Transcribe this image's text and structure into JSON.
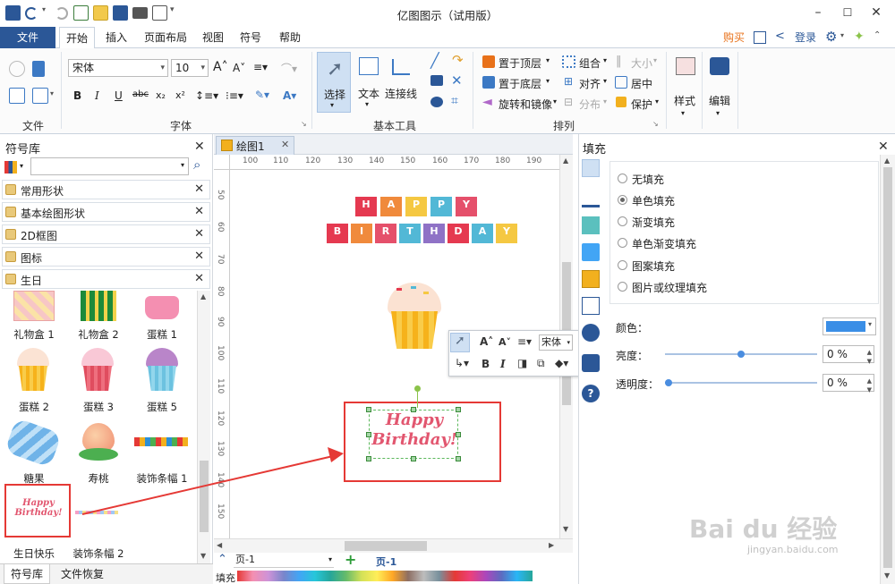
{
  "window": {
    "title": "亿图图示（试用版）"
  },
  "tabs": [
    {
      "label": "文件"
    },
    {
      "label": "开始"
    },
    {
      "label": "插入"
    },
    {
      "label": "页面布局"
    },
    {
      "label": "视图"
    },
    {
      "label": "符号"
    },
    {
      "label": "帮助"
    }
  ],
  "top_right": {
    "buy": "购买",
    "login": "登录"
  },
  "ribbon": {
    "groups": {
      "file": "文件",
      "font": "字体",
      "basic_tools": "基本工具",
      "arrange": "排列"
    },
    "font_name": "宋体",
    "font_size": "10",
    "tools": {
      "select": "选择",
      "text": "文本",
      "connector": "连接线"
    },
    "arrange": {
      "bring_front": "置于顶层",
      "send_back": "置于底层",
      "rotate_mirror": "旋转和镜像",
      "group": "组合",
      "align": "对齐",
      "distribute": "分布",
      "size": "大小",
      "center": "居中",
      "protect": "保护"
    },
    "style": "样式",
    "edit": "编辑"
  },
  "library": {
    "title": "符号库",
    "search_placeholder": "",
    "categories": [
      "常用形状",
      "基本绘图形状",
      "2D框图",
      "图标",
      "生日"
    ],
    "shapes": [
      "礼物盒 1",
      "礼物盒 2",
      "蛋糕 1",
      "蛋糕 2",
      "蛋糕 3",
      "蛋糕 5",
      "糖果",
      "寿桃",
      "装饰条幅 1",
      "生日快乐",
      "装饰条幅 2"
    ],
    "bottom_tabs": [
      "符号库",
      "文件恢复"
    ]
  },
  "document": {
    "tab": "绘图1",
    "ruler_h": [
      "100",
      "110",
      "120",
      "130",
      "140",
      "150",
      "160",
      "170",
      "180",
      "190"
    ],
    "ruler_v": [
      "50",
      "60",
      "70",
      "80",
      "90",
      "100",
      "110",
      "120",
      "130",
      "140",
      "150"
    ],
    "banner_top": [
      "H",
      "A",
      "P",
      "P",
      "Y"
    ],
    "banner_bottom": [
      "B",
      "I",
      "R",
      "T",
      "H",
      "D",
      "A",
      "Y"
    ],
    "birthday_line1": "Happy",
    "birthday_line2": "Birthday!",
    "page_select": "页-1",
    "page_tab": "页-1",
    "fill_label": "填充"
  },
  "floatbar": {
    "font": "宋体"
  },
  "fill_panel": {
    "title": "填充",
    "options": [
      "无填充",
      "单色填充",
      "渐变填充",
      "单色渐变填充",
      "图案填充",
      "图片或纹理填充"
    ],
    "selected_index": 1,
    "color_label": "颜色：",
    "color_value": "#3a8ee6",
    "brightness_label": "亮度：",
    "brightness_value": "0 %",
    "brightness_level": 0.5,
    "transparency_label": "透明度：",
    "transparency_value": "0 %",
    "transparency_level": 0
  },
  "watermark": {
    "brand": "Bai du 经验",
    "url": "jingyan.baidu.com"
  },
  "colors": {
    "accent": "#2b5797",
    "annotation_red": "#e53935"
  }
}
